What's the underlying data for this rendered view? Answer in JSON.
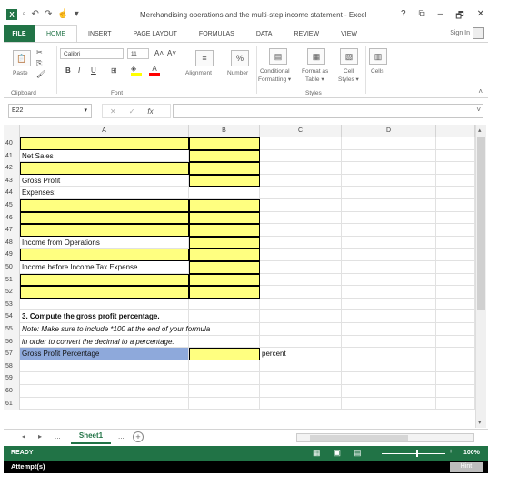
{
  "window": {
    "title": "Merchandising operations and the multi-step income statement - Excel",
    "controls": [
      "?",
      "⧉",
      "–",
      "🗗",
      "✕"
    ]
  },
  "ribbon": {
    "file_tab": "FILE",
    "tabs": [
      "HOME",
      "INSERT",
      "PAGE LAYOUT",
      "FORMULAS",
      "DATA",
      "REVIEW",
      "VIEW"
    ],
    "active_tab": "HOME",
    "sign_in": "Sign In",
    "clipboard": {
      "paste": "Paste",
      "label": "Clipboard"
    },
    "font": {
      "name": "Calibri",
      "size": "11",
      "label": "Font",
      "bold": "B",
      "italic": "I",
      "underline": "U"
    },
    "alignment": {
      "label": "Alignment"
    },
    "number": {
      "label": "Number",
      "icon_text": "%"
    },
    "styles": {
      "conditional": "Conditional",
      "formatting": "Formatting ▾",
      "format_as": "Format as",
      "table": "Table ▾",
      "cell": "Cell",
      "cell_styles": "Styles ▾",
      "label": "Styles"
    },
    "cells": {
      "label": "Cells"
    }
  },
  "formula_bar": {
    "name_box": "E22",
    "fx": "fx",
    "value": ""
  },
  "columns": [
    "A",
    "B",
    "C",
    "D"
  ],
  "rows": [
    {
      "num": "40",
      "a": "",
      "b": "",
      "c": "",
      "a_style": "yel",
      "b_style": "yel"
    },
    {
      "num": "41",
      "a": "Net Sales",
      "b": "",
      "c": "",
      "a_style": "",
      "b_style": "yel"
    },
    {
      "num": "42",
      "a": "",
      "b": "",
      "c": "",
      "a_style": "yel",
      "b_style": "yel"
    },
    {
      "num": "43",
      "a": "Gross Profit",
      "b": "",
      "c": "",
      "a_style": "",
      "b_style": "yel"
    },
    {
      "num": "44",
      "a": "Expenses:",
      "b": "",
      "c": "",
      "a_style": "",
      "b_style": ""
    },
    {
      "num": "45",
      "a": "",
      "b": "",
      "c": "",
      "a_style": "yel",
      "b_style": "yel"
    },
    {
      "num": "46",
      "a": "",
      "b": "",
      "c": "",
      "a_style": "yel",
      "b_style": "yel"
    },
    {
      "num": "47",
      "a": "",
      "b": "",
      "c": "",
      "a_style": "yel",
      "b_style": "yel"
    },
    {
      "num": "48",
      "a": "Income from Operations",
      "b": "",
      "c": "",
      "a_style": "",
      "b_style": "yel"
    },
    {
      "num": "49",
      "a": "",
      "b": "",
      "c": "",
      "a_style": "yel",
      "b_style": "yel"
    },
    {
      "num": "50",
      "a": "Income before Income Tax Expense",
      "b": "",
      "c": "",
      "a_style": "",
      "b_style": "yel"
    },
    {
      "num": "51",
      "a": "",
      "b": "",
      "c": "",
      "a_style": "yel",
      "b_style": "yel"
    },
    {
      "num": "52",
      "a": "",
      "b": "",
      "c": "",
      "a_style": "yel",
      "b_style": "yel"
    },
    {
      "num": "53",
      "a": "",
      "b": "",
      "c": "",
      "a_style": "",
      "b_style": ""
    },
    {
      "num": "54",
      "a": "3. Compute the gross profit percentage.",
      "b": "",
      "c": "",
      "a_style": "bold",
      "b_style": ""
    },
    {
      "num": "55",
      "a": "Note:  Make sure to include *100 at the end of your formula",
      "b": "",
      "c": "",
      "a_style": "ital",
      "b_style": ""
    },
    {
      "num": "56",
      "a": "in order to convert the decimal to a percentage.",
      "b": "",
      "c": "",
      "a_style": "ital",
      "b_style": ""
    },
    {
      "num": "57",
      "a": "Gross Profit Percentage",
      "b": "",
      "c": "percent",
      "a_style": "blue",
      "b_style": "yel"
    },
    {
      "num": "58",
      "a": "",
      "b": "",
      "c": "",
      "a_style": "",
      "b_style": ""
    },
    {
      "num": "59",
      "a": "",
      "b": "",
      "c": "",
      "a_style": "",
      "b_style": ""
    },
    {
      "num": "60",
      "a": "",
      "b": "",
      "c": "",
      "a_style": "",
      "b_style": ""
    },
    {
      "num": "61",
      "a": "",
      "b": "",
      "c": "",
      "a_style": "",
      "b_style": ""
    }
  ],
  "sheets": {
    "active": "Sheet1",
    "more": "...",
    "nav_prev": "◂",
    "nav_next": "▸",
    "nav_more": "..."
  },
  "status": {
    "ready": "READY",
    "zoom": "100%"
  },
  "footer": {
    "attempts": "Attempt(s)",
    "hint": "Hint"
  }
}
